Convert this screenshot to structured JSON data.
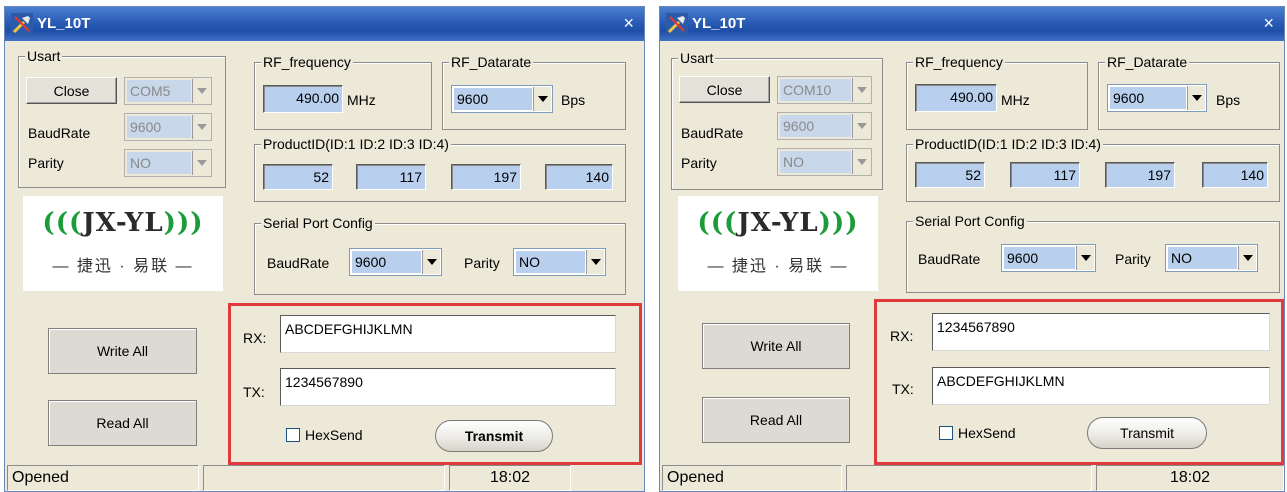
{
  "accent_red": "#e0393e",
  "windows": [
    {
      "title": "YL_10T",
      "close_glyph": "×",
      "usart": {
        "legend": "Usart",
        "close_button": "Close",
        "com_port": "COM5",
        "baud_label": "BaudRate",
        "baud_value": "9600",
        "parity_label": "Parity",
        "parity_value": "NO"
      },
      "rf_frequency": {
        "legend": "RF_frequency",
        "value": "490.00",
        "unit": "MHz"
      },
      "rf_datarate": {
        "legend": "RF_Datarate",
        "value": "9600",
        "unit": "Bps"
      },
      "product_id": {
        "legend": "ProductID(ID:1 ID:2 ID:3 ID:4)",
        "ids": [
          "52",
          "117",
          "197",
          "140"
        ]
      },
      "logo": {
        "brand": "JX-YL",
        "subtitle": "— 捷迅 · 易联 —"
      },
      "serial_config": {
        "legend": "Serial Port Config",
        "baud_label": "BaudRate",
        "baud_value": "9600",
        "parity_label": "Parity",
        "parity_value": "NO"
      },
      "write_all": "Write All",
      "read_all": "Read All",
      "rx_label": "RX:",
      "rx_value": "ABCDEFGHIJKLMN",
      "tx_label": "TX:",
      "tx_value": "1234567890",
      "hexsend_label": "HexSend",
      "transmit_label": "Transmit",
      "status": {
        "state": "Opened",
        "middle": "",
        "time": "18:02"
      }
    },
    {
      "title": "YL_10T",
      "close_glyph": "×",
      "usart": {
        "legend": "Usart",
        "close_button": "Close",
        "com_port": "COM10",
        "baud_label": "BaudRate",
        "baud_value": "9600",
        "parity_label": "Parity",
        "parity_value": "NO"
      },
      "rf_frequency": {
        "legend": "RF_frequency",
        "value": "490.00",
        "unit": "MHz"
      },
      "rf_datarate": {
        "legend": "RF_Datarate",
        "value": "9600",
        "unit": "Bps"
      },
      "product_id": {
        "legend": "ProductID(ID:1 ID:2 ID:3 ID:4)",
        "ids": [
          "52",
          "117",
          "197",
          "140"
        ]
      },
      "logo": {
        "brand": "JX-YL",
        "subtitle": "— 捷迅 · 易联 —"
      },
      "serial_config": {
        "legend": "Serial Port Config",
        "baud_label": "BaudRate",
        "baud_value": "9600",
        "parity_label": "Parity",
        "parity_value": "NO"
      },
      "write_all": "Write All",
      "read_all": "Read All",
      "rx_label": "RX:",
      "rx_value": "1234567890",
      "tx_label": "TX:",
      "tx_value": "ABCDEFGHIJKLMN",
      "hexsend_label": "HexSend",
      "transmit_label": "Transmit",
      "status": {
        "state": "Opened",
        "middle": "",
        "time": "18:02"
      }
    }
  ]
}
